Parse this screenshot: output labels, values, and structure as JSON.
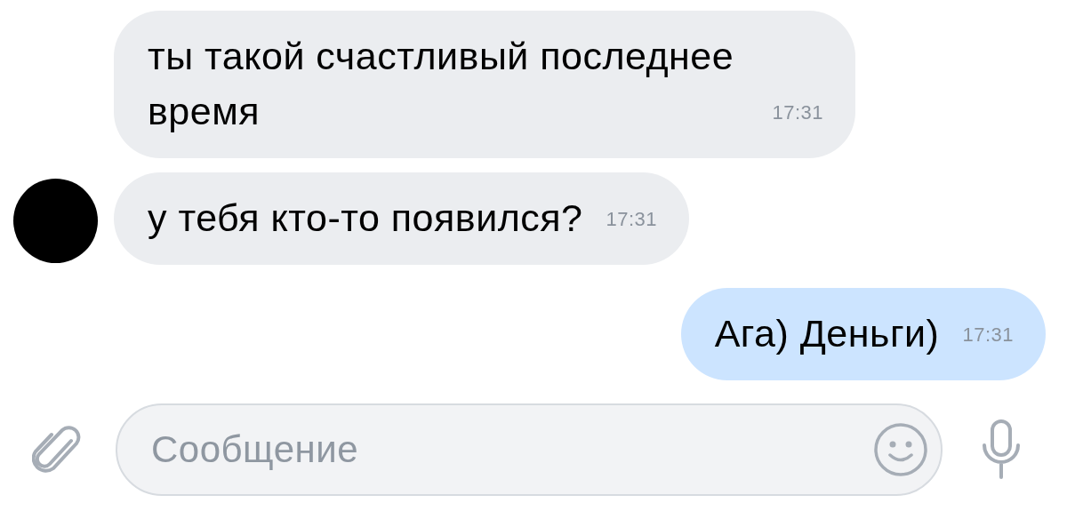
{
  "messages": [
    {
      "kind": "incoming",
      "avatar": false,
      "text": "ты такой счастливый последнее время",
      "time": "17:31"
    },
    {
      "kind": "incoming",
      "avatar": true,
      "text": "у тебя кто-то появился?",
      "time": "17:31"
    },
    {
      "kind": "outgoing",
      "text": "Ага) Деньги)",
      "time": "17:31"
    }
  ],
  "composer": {
    "placeholder": "Сообщение"
  }
}
